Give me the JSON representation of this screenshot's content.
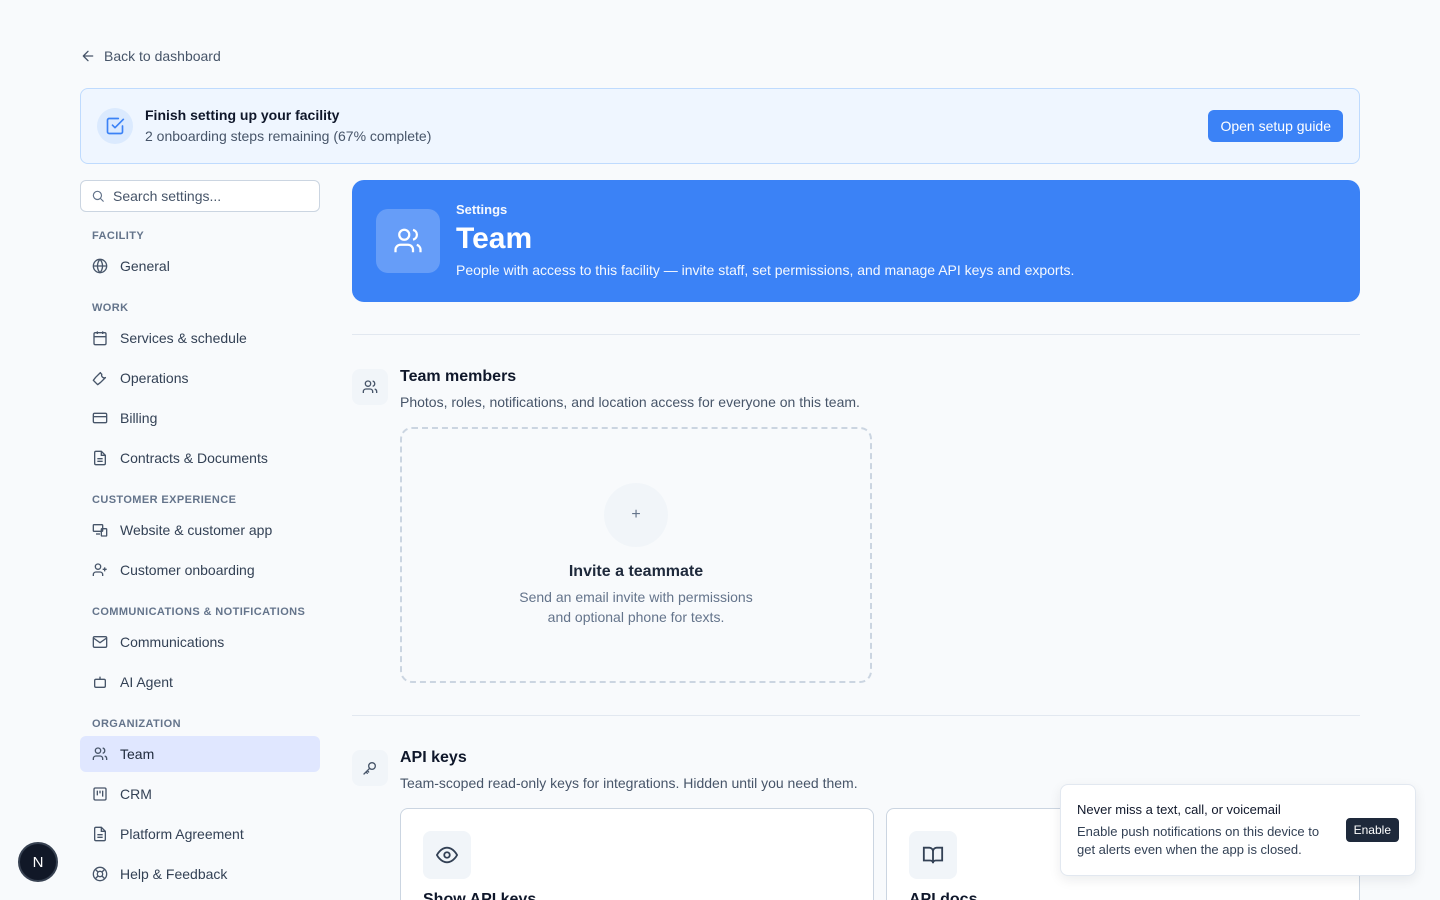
{
  "back": {
    "label": "Back to dashboard"
  },
  "setup": {
    "title": "Finish setting up your facility",
    "subtitle": "2 onboarding steps remaining (67% complete)",
    "button": "Open setup guide",
    "progress_percent": 67
  },
  "sidebar": {
    "search_placeholder": "Search settings...",
    "groups": [
      {
        "label": "FACILITY",
        "items": [
          {
            "label": "General",
            "icon": "globe-icon"
          }
        ]
      },
      {
        "label": "WORK",
        "items": [
          {
            "label": "Services & schedule",
            "icon": "calendar-icon"
          },
          {
            "label": "Operations",
            "icon": "wrench-icon"
          },
          {
            "label": "Billing",
            "icon": "credit-card-icon"
          },
          {
            "label": "Contracts & Documents",
            "icon": "document-icon"
          }
        ]
      },
      {
        "label": "CUSTOMER EXPERIENCE",
        "items": [
          {
            "label": "Website & customer app",
            "icon": "devices-icon"
          },
          {
            "label": "Customer onboarding",
            "icon": "user-plus-icon"
          }
        ]
      },
      {
        "label": "COMMUNICATIONS & NOTIFICATIONS",
        "items": [
          {
            "label": "Communications",
            "icon": "mail-icon"
          },
          {
            "label": "AI Agent",
            "icon": "bot-icon"
          }
        ]
      },
      {
        "label": "ORGANIZATION",
        "items": [
          {
            "label": "Team",
            "icon": "users-icon",
            "active": true
          },
          {
            "label": "CRM",
            "icon": "kanban-icon"
          },
          {
            "label": "Platform Agreement",
            "icon": "document-icon"
          },
          {
            "label": "Help & Feedback",
            "icon": "lifebuoy-icon"
          }
        ]
      }
    ]
  },
  "hero": {
    "eyebrow": "Settings",
    "title": "Team",
    "subtitle": "People with access to this facility — invite staff, set permissions, and manage API keys and exports."
  },
  "team_section": {
    "title": "Team members",
    "subtitle": "Photos, roles, notifications, and location access for everyone on this team.",
    "invite": {
      "plus": "+",
      "title": "Invite a teammate",
      "subtitle": "Send an email invite with permissions and optional phone for texts."
    }
  },
  "api_section": {
    "title": "API keys",
    "subtitle": "Team-scoped read-only keys for integrations. Hidden until you need them.",
    "cards": [
      {
        "title": "Show API keys",
        "icon": "eye-icon"
      },
      {
        "title": "API docs",
        "icon": "book-icon"
      }
    ]
  },
  "toast": {
    "title": "Never miss a text, call, or voicemail",
    "body": "Enable push notifications on this device to get alerts even when the app is closed.",
    "button": "Enable"
  },
  "dev_badge": {
    "letter": "N"
  },
  "colors": {
    "accent": "#3b82f6",
    "active_nav": "#e0e7ff",
    "banner_bg": "#eff6ff"
  }
}
